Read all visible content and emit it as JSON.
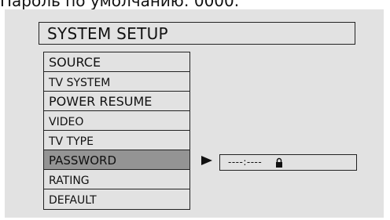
{
  "caption": "Пароль по умолчанию: 0000.",
  "title": "SYSTEM SETUP",
  "menu": {
    "items": [
      {
        "label": "SOURCE",
        "selected": false
      },
      {
        "label": "TV SYSTEM",
        "selected": false
      },
      {
        "label": "POWER RESUME",
        "selected": false
      },
      {
        "label": "VIDEO",
        "selected": false
      },
      {
        "label": "TV TYPE",
        "selected": false
      },
      {
        "label": "PASSWORD",
        "selected": true
      },
      {
        "label": "RATING",
        "selected": false
      },
      {
        "label": "DEFAULT",
        "selected": false
      }
    ]
  },
  "password": {
    "value": "----:----",
    "icon": "lock-icon"
  },
  "colors": {
    "panel": "#e2e2e2",
    "selected": "#949494",
    "border": "#222222"
  }
}
